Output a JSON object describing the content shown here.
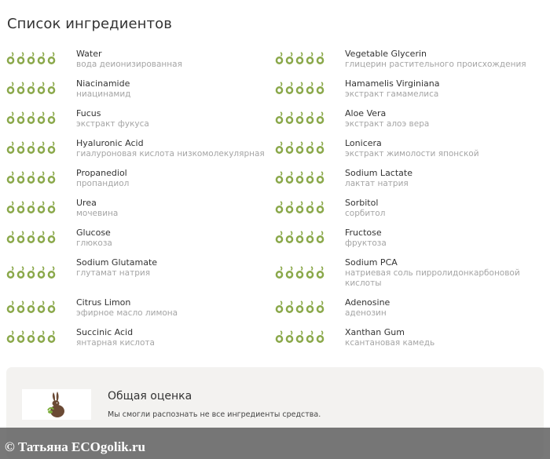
{
  "page_title": "Список ингредиентов",
  "colors": {
    "rating_dot": "#8aa84a",
    "watermark_bg": "#5a5a5a",
    "card_bg": "#f3f2f0"
  },
  "ingredients": [
    {
      "name": "Water",
      "description": "вода деионизированная",
      "rating": 5
    },
    {
      "name": "Vegetable Glycerin",
      "description": "глицерин растительного происхождения",
      "rating": 5
    },
    {
      "name": "Niacinamide",
      "description": "ниацинамид",
      "rating": 5
    },
    {
      "name": "Hamamelis Virginiana",
      "description": "экстракт гамамелиса",
      "rating": 5
    },
    {
      "name": "Fucus",
      "description": "экстракт фукуса",
      "rating": 5
    },
    {
      "name": "Aloe Vera",
      "description": "экстракт алоэ вера",
      "rating": 5
    },
    {
      "name": "Hyaluronic Acid",
      "description": "гиалуроновая кислота низкомолекулярная",
      "rating": 5
    },
    {
      "name": "Lonicera",
      "description": "экстракт жимолости японской",
      "rating": 5
    },
    {
      "name": "Propanediol",
      "description": "пропандиол",
      "rating": 5
    },
    {
      "name": "Sodium Lactate",
      "description": "лактат натрия",
      "rating": 5
    },
    {
      "name": "Urea",
      "description": "мочевина",
      "rating": 5
    },
    {
      "name": "Sorbitol",
      "description": "сорбитол",
      "rating": 5
    },
    {
      "name": "Glucose",
      "description": "глюкоза",
      "rating": 5
    },
    {
      "name": "Fructose",
      "description": "фруктоза",
      "rating": 5
    },
    {
      "name": "Sodium Glutamate",
      "description": "глутамат натрия",
      "rating": 5
    },
    {
      "name": "Sodium PCA",
      "description": "натриевая соль пирролидонкарбоновой кислоты",
      "rating": 5
    },
    {
      "name": "Citrus Limon",
      "description": "эфирное масло лимона",
      "rating": 5
    },
    {
      "name": "Adenosine",
      "description": "аденозин",
      "rating": 5
    },
    {
      "name": "Succinic Acid",
      "description": "янтарная кислота",
      "rating": 5
    },
    {
      "name": "Xanthan Gum",
      "description": "ксантановая камедь",
      "rating": 5
    }
  ],
  "summary": {
    "title": "Общая оценка",
    "text": "Мы смогли распознать  не все ингредиенты средства.",
    "logo_icon": "rabbit-icon"
  },
  "watermark": {
    "text": "© Татьяна  ECOgolik.ru"
  }
}
